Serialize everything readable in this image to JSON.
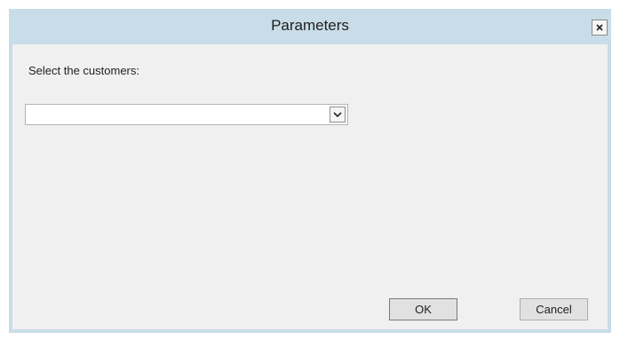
{
  "window": {
    "title": "Parameters",
    "close_icon": "close-icon"
  },
  "dialog": {
    "prompt": "Select the customers:",
    "customers_select": {
      "value": "",
      "dropdown_icon": "chevron-down-icon"
    },
    "ok_label": "OK",
    "cancel_label": "Cancel"
  },
  "colors": {
    "titlebar": "#c9dde8",
    "client_background": "#f0f0f0",
    "button_face": "#e1e1e1"
  }
}
